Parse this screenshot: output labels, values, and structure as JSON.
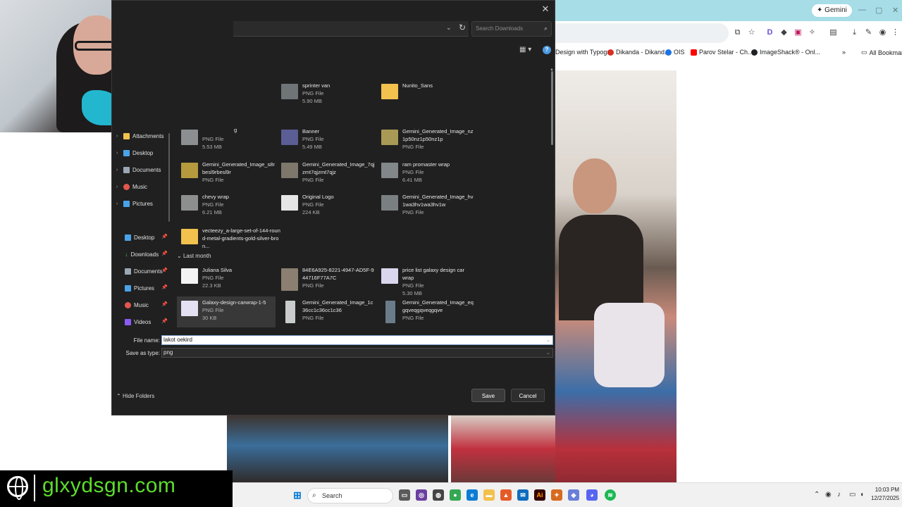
{
  "browser": {
    "tab_gemini": "Gemini",
    "bookmarks": [
      {
        "label": "Design with Typogr...",
        "color": "#9aa0a6"
      },
      {
        "label": "Dikanda - Dikand...",
        "color": "#d93025"
      },
      {
        "label": "OIS",
        "color": "#d93025"
      },
      {
        "label": "Parov Stelar - Ch...",
        "color": "#ff0000"
      },
      {
        "label": "ImageShack® - Onl...",
        "color": "#202124"
      }
    ],
    "all_bookmarks": "All Bookmarks"
  },
  "dialog": {
    "search_placeholder": "Search Downloads",
    "nav_top": [
      {
        "label": "Attachments",
        "color": "#f2c14e"
      },
      {
        "label": "Desktop",
        "color": "#4aa3e8"
      },
      {
        "label": "Documents",
        "color": "#9aa7b5"
      },
      {
        "label": "Music",
        "color": "#e2574c"
      },
      {
        "label": "Pictures",
        "color": "#4aa3e8"
      }
    ],
    "nav_quick": [
      {
        "label": "Desktop",
        "color": "#4aa3e8"
      },
      {
        "label": "Downloads",
        "color": "#3fb950"
      },
      {
        "label": "Documents",
        "color": "#9aa7b5"
      },
      {
        "label": "Pictures",
        "color": "#4aa3e8"
      },
      {
        "label": "Music",
        "color": "#e2574c"
      },
      {
        "label": "Videos",
        "color": "#8a5cf5"
      }
    ],
    "files_recent": [
      {
        "name": "sprinter van",
        "type": "PNG File",
        "size": "5.90 MB",
        "thumb": "#6f7476"
      },
      {
        "name": "Nunito_Sans",
        "type": "",
        "size": "",
        "thumb": "#f2c14e"
      },
      {
        "name": "g",
        "type": "PNG File",
        "size": "5.53 MB",
        "thumb": "#8b8f92"
      },
      {
        "name": "Banner",
        "type": "PNG File",
        "size": "5.49 MB",
        "thumb": "#5b5e95"
      },
      {
        "name": "Gemini_Generated_Image_nz1p50nz1p50nz1p",
        "type": "PNG File",
        "size": "",
        "thumb": "#a89a55"
      },
      {
        "name": "Gemini_Generated_Image_s8rbesl9rbesl9r",
        "type": "PNG File",
        "size": "",
        "thumb": "#b59b3e"
      },
      {
        "name": "Gemini_Generated_Image_7qjzmt7qjzmt7qjz",
        "type": "PNG File",
        "size": "",
        "thumb": "#7d776c"
      },
      {
        "name": "ram promaster wrap",
        "type": "PNG File",
        "size": "6.41 MB",
        "thumb": "#82878a"
      },
      {
        "name": "chevy wrap",
        "type": "PNG File",
        "size": "6.21 MB",
        "thumb": "#8d8f8f"
      },
      {
        "name": "Original Logo",
        "type": "PNG File",
        "size": "224 KB",
        "thumb": "#e6e6e6"
      },
      {
        "name": "Gemini_Generated_Image_hv1wa3hv1wa3hv1w",
        "type": "PNG File",
        "size": "",
        "thumb": "#7a8082"
      },
      {
        "name": "vecteezy_a-large-set-of-144-round-metal-gradients-gold-silver-bron...",
        "type": "",
        "size": "",
        "thumb": "#f2c14e"
      }
    ],
    "group_last_month": "Last month",
    "files_last_month": [
      {
        "name": "Juliana Silva",
        "type": "PNG File",
        "size": "22.3 KB",
        "thumb": "#f3f3f3"
      },
      {
        "name": "84E6A925-8221-4947-AD5F-944716F77A7C",
        "type": "PNG File",
        "size": "",
        "thumb": "#8a7f70"
      },
      {
        "name": "price list galaxy design car wrap",
        "type": "PNG File",
        "size": "5.30 MB",
        "thumb": "#d9d6ee"
      },
      {
        "name": "Galaxy-design-carwrap-1-5",
        "type": "PNG File",
        "size": "30 KB",
        "thumb": "#e4e1f3"
      },
      {
        "name": "Gemini_Generated_Image_1c36cc1c36cc1c36",
        "type": "PNG File",
        "size": "",
        "thumb": "#c9cccd"
      },
      {
        "name": "Gemini_Generated_Image_eqgqveqgqveqgqve",
        "type": "PNG File",
        "size": "",
        "thumb": "#6a7c8a"
      }
    ],
    "file_name_label": "File name:",
    "file_name_value": "lakot oekird",
    "save_type_label": "Save as type:",
    "save_type_value": "png",
    "hide_folders": "Hide Folders",
    "save_label": "Save",
    "cancel_label": "Cancel"
  },
  "taskbar": {
    "search_label": "Search",
    "time": "10:03 PM",
    "date": "12/27/2025"
  },
  "overlay": {
    "brand": "glxydsgn.com"
  }
}
